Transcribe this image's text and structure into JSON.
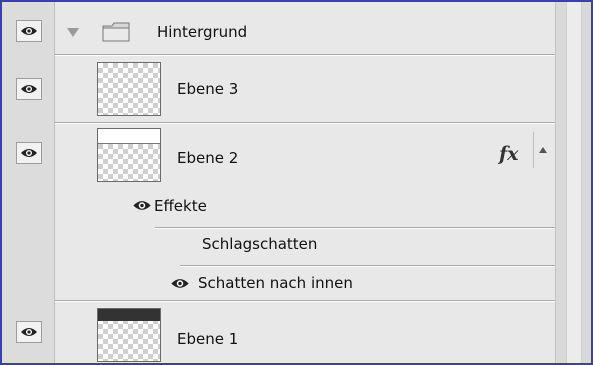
{
  "layers_panel": {
    "group": {
      "name": "Hintergrund",
      "expanded": true,
      "icon": "folder-icon",
      "disclosure_icon": "triangle-down-icon"
    },
    "layers": [
      {
        "name": "Ebene 3",
        "visible": true
      },
      {
        "name": "Ebene 2",
        "visible": true,
        "fx_label": "fx",
        "effects": {
          "title": "Effekte",
          "items": [
            {
              "name": "Schlagschatten",
              "visible": false
            },
            {
              "name": "Schatten nach innen",
              "visible": true
            }
          ]
        }
      },
      {
        "name": "Ebene 1",
        "visible": true
      }
    ]
  },
  "colors": {
    "border_accent": "#3a3eb0",
    "panel_bg": "#e8e8e8",
    "selected_band": "#333333"
  }
}
